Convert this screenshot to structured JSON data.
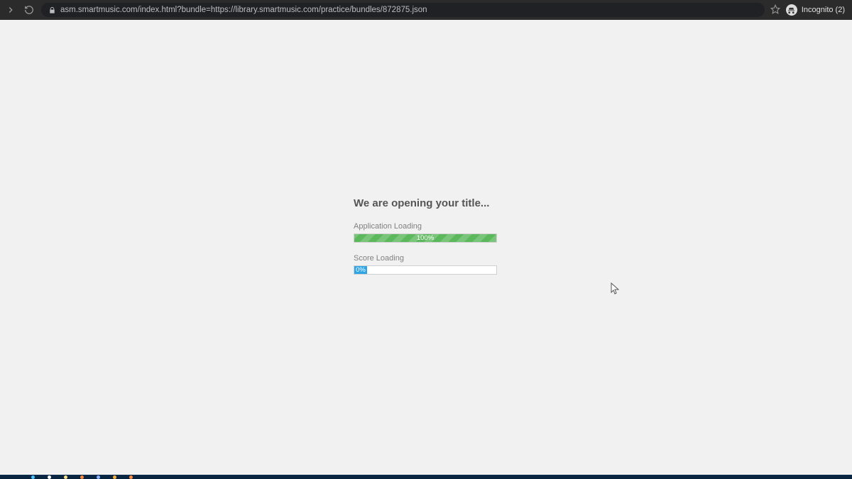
{
  "browser": {
    "url": "asm.smartmusic.com/index.html?bundle=https://library.smartmusic.com/practice/bundles/872875.json",
    "profile_label": "Incognito (2)"
  },
  "page": {
    "heading": "We are opening your title...",
    "app_loading": {
      "label": "Application Loading",
      "percent_text": "100%",
      "percent": 100
    },
    "score_loading": {
      "label": "Score Loading",
      "percent_text": "0%",
      "percent": 0
    }
  },
  "colors": {
    "green": "#5cb85c",
    "blue": "#2fa4e7",
    "page_bg": "#f1f1f1"
  }
}
